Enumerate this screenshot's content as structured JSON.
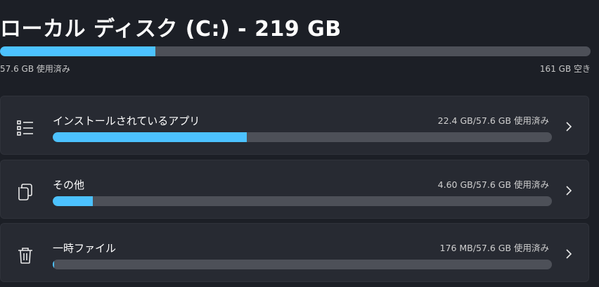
{
  "drive": {
    "title": "ローカル ディスク (C:) - 219 GB",
    "used_label": "57.6 GB 使用済み",
    "free_label": "161 GB 空き",
    "used_fraction": 0.263
  },
  "categories": [
    {
      "name": "インストールされているアプリ",
      "usage": "22.4 GB/57.6 GB 使用済み",
      "fraction": 0.389,
      "icon": "app-list-icon"
    },
    {
      "name": "その他",
      "usage": "4.60 GB/57.6 GB 使用済み",
      "fraction": 0.08,
      "icon": "document-icon"
    },
    {
      "name": "一時ファイル",
      "usage": "176 MB/57.6 GB 使用済み",
      "fraction": 0.003,
      "icon": "trash-icon"
    }
  ],
  "colors": {
    "background": "#1c1f26",
    "card": "#272a32",
    "accent": "#4cc2ff",
    "track": "#4d5058"
  }
}
